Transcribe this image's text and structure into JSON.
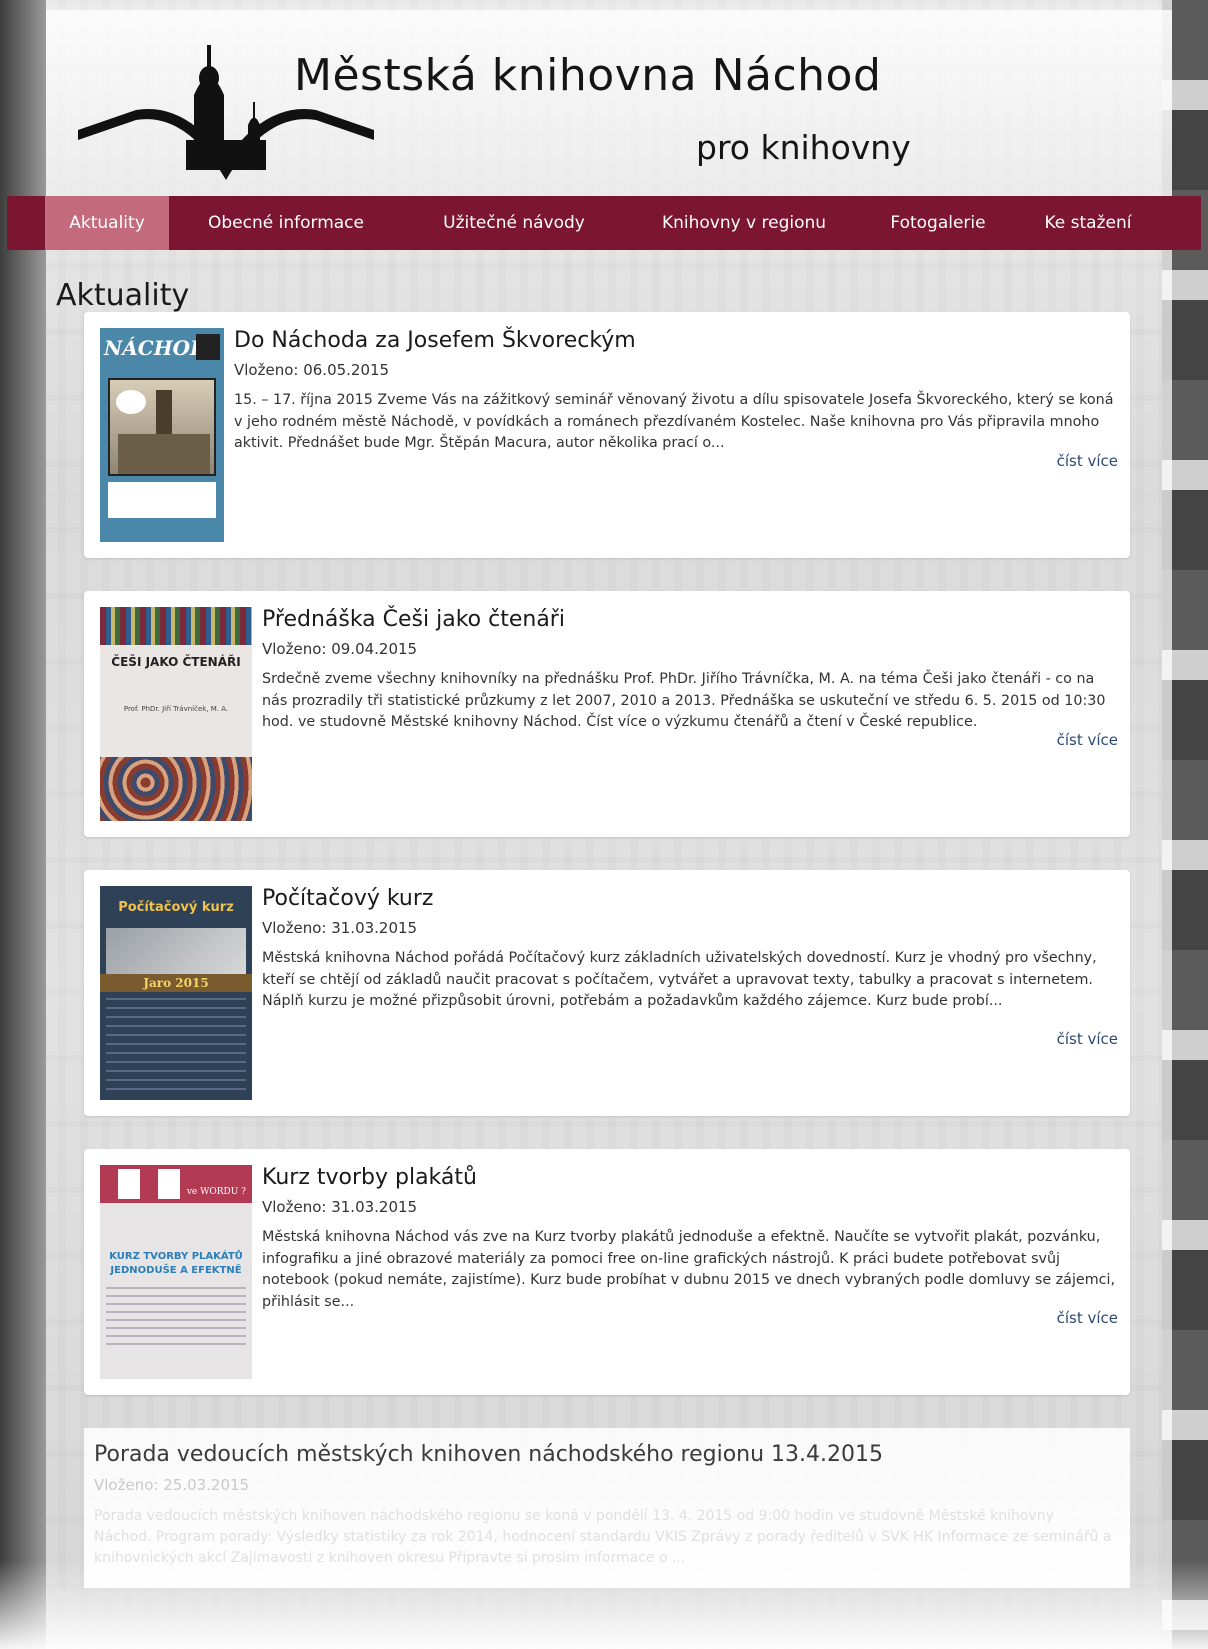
{
  "site": {
    "title": "Městská knihovna Náchod",
    "subtitle": "pro knihovny"
  },
  "nav": {
    "items": [
      {
        "label": "Aktuality",
        "active": true
      },
      {
        "label": "Obecné informace"
      },
      {
        "label": "Užitečné návody"
      },
      {
        "label": "Knihovny v regionu"
      },
      {
        "label": "Fotogalerie"
      },
      {
        "label": "Ke stažení"
      }
    ]
  },
  "page": {
    "heading": "Aktuality"
  },
  "thumbs": {
    "t1": {
      "title": "NÁCHOD"
    },
    "t2": {
      "title": "ČEŠI JAKO ČTENÁŘI",
      "author": "Prof. PhDr. Jiří Trávníček, M. A."
    },
    "t3": {
      "title": "Počítačový kurz",
      "season": "Jaro 2015"
    },
    "t4": {
      "title": "KURZ TVORBY PLAKÁTŮ",
      "subtitle": "JEDNODUŠE A EFEKTNĚ",
      "tag": "ve WORDU ?"
    }
  },
  "articles": [
    {
      "title": "Do Náchoda za Josefem Škvoreckým",
      "date": "Vloženo: 06.05.2015",
      "text": "15. – 17. října 2015 Zveme Vás na zážitkový seminář věnovaný životu a dílu spisovatele Josefa Škvoreckého, který se koná v jeho rodném městě Náchodě, v povídkách a románech přezdívaném Kostelec. Naše knihovna pro Vás připravila mnoho aktivit.  Přednášet bude Mgr. Štěpán Macura, autor několika prací o...",
      "more": "číst více"
    },
    {
      "title": "Přednáška Češi jako čtenáři",
      "date": "Vloženo: 09.04.2015",
      "text": "Srdečně zveme všechny knihovníky na přednášku Prof. PhDr. Jiřího Trávníčka, M. A. na téma Češi jako čtenáři - co na nás prozradily tři statistické průzkumy z let 2007, 2010 a 2013. Přednáška se uskuteční ve středu 6. 5. 2015 od 10:30 hod. ve studovně Městské knihovny Náchod. Číst více o výzkumu čtenářů a čtení v České republice.",
      "more": "číst více"
    },
    {
      "title": "Počítačový kurz",
      "date": "Vloženo: 31.03.2015",
      "text": "Městská knihovna Náchod pořádá Počítačový kurz základních uživatelských dovedností. Kurz je vhodný pro všechny, kteří se chtějí od základů naučit pracovat s počítačem, vytvářet a upravovat texty, tabulky a pracovat s internetem. Náplň kurzu je možné přizpůsobit úrovni, potřebám a požadavkům každého zájemce. Kurz bude probí...",
      "more": "číst více"
    },
    {
      "title": "Kurz tvorby plakátů",
      "date": "Vloženo: 31.03.2015",
      "text": "Městská knihovna Náchod vás zve na Kurz tvorby plakátů jednoduše a efektně. Naučíte se vytvořit plakát, pozvánku, infografiku a jiné obrazové materiály za pomoci free on-line grafických nástrojů. K práci budete potřebovat svůj notebook (pokud nemáte, zajistíme). Kurz bude probíhat v dubnu 2015 ve dnech vybraných podle domluvy se zájemci, přihlásit se...",
      "more": "číst více"
    },
    {
      "title": "Porada vedoucích městských knihoven náchodského regionu 13.4.2015",
      "date": "Vloženo: 25.03.2015",
      "text": "Porada vedoucích městských knihoven náchodského regionu se koná v pondělí 13. 4. 2015 od 9:00 hodin ve studovně Městské knihovny Náchod. Program porady: Výsledky statistiky za rok 2014, hodnocení standardu VKIS Zprávy z porady ředitelů v SVK HK Informace ze seminářů a knihovnických akcí Zajímavosti z knihoven okresu Připravte si prosím informace o ..."
    }
  ]
}
